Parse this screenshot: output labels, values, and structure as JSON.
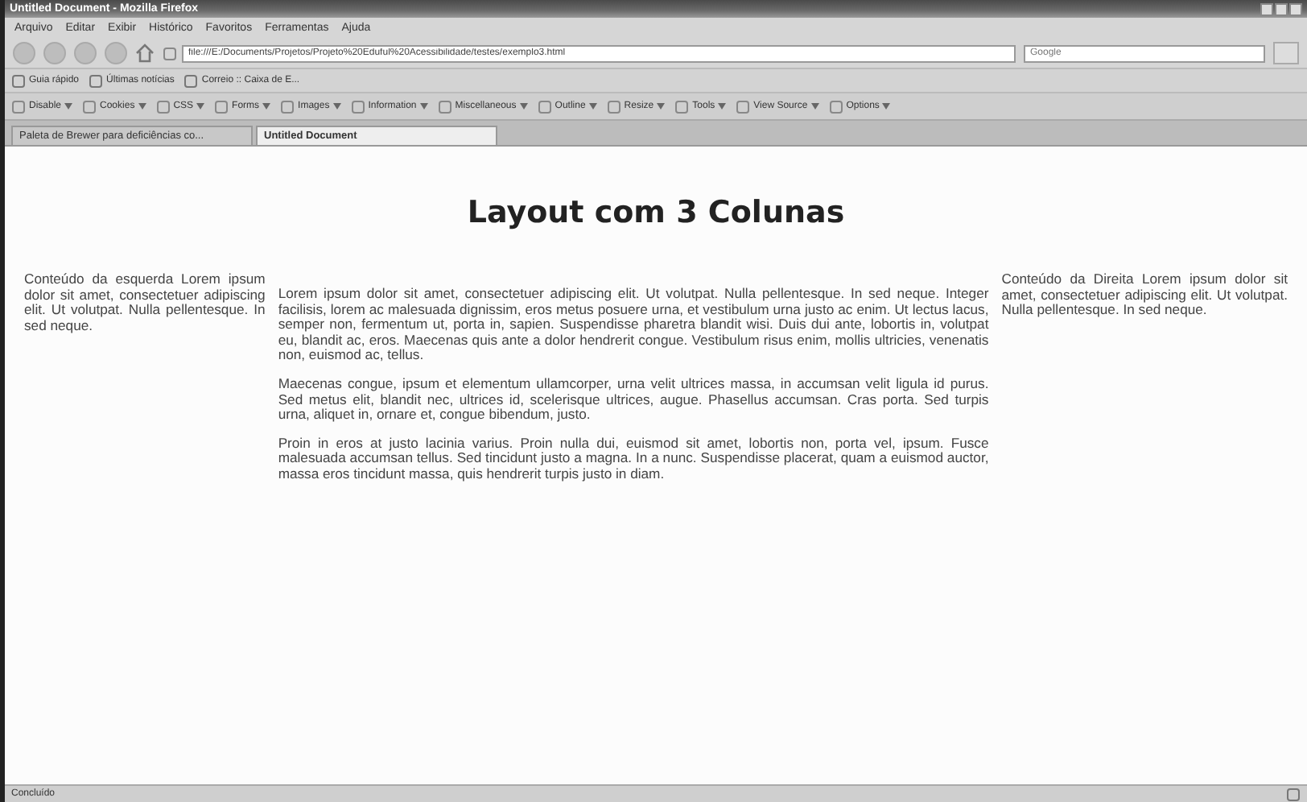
{
  "window": {
    "title": "Untitled Document - Mozilla Firefox"
  },
  "menu": [
    "Arquivo",
    "Editar",
    "Exibir",
    "Histórico",
    "Favoritos",
    "Ferramentas",
    "Ajuda"
  ],
  "address_bar": {
    "value": "file:///E:/Documents/Projetos/Projeto%20Eduful%20Acessibilidade/testes/exemplo3.html"
  },
  "search": {
    "placeholder": "Google"
  },
  "bookmarks": [
    "Guia rápido",
    "Últimas notícias",
    "Correio :: Caixa de E..."
  ],
  "webdev_toolbar": [
    "Disable",
    "Cookies",
    "CSS",
    "Forms",
    "Images",
    "Information",
    "Miscellaneous",
    "Outline",
    "Resize",
    "Tools",
    "View Source",
    "Options"
  ],
  "tabs": [
    {
      "label": "Paleta de Brewer para deficiências co...",
      "selected": false
    },
    {
      "label": "Untitled Document",
      "selected": true
    }
  ],
  "page": {
    "heading": "Layout com 3 Colunas",
    "left": "Conteúdo da esquerda Lorem ipsum dolor sit amet, consectetuer adipiscing elit. Ut volutpat. Nulla pellentesque. In sed neque.",
    "center": [
      "Lorem ipsum dolor sit amet, consectetuer adipiscing elit. Ut volutpat. Nulla pellentesque. In sed neque. Integer facilisis, lorem ac malesuada dignissim, eros metus posuere urna, et vestibulum urna justo ac enim. Ut lectus lacus, semper non, fermentum ut, porta in, sapien. Suspendisse pharetra blandit wisi. Duis dui ante, lobortis in, volutpat eu, blandit ac, eros. Maecenas quis ante a dolor hendrerit congue. Vestibulum risus enim, mollis ultricies, venenatis non, euismod ac, tellus.",
      "Maecenas congue, ipsum et elementum ullamcorper, urna velit ultrices massa, in accumsan velit ligula id purus. Sed metus elit, blandit nec, ultrices id, scelerisque ultrices, augue. Phasellus accumsan. Cras porta. Sed turpis urna, aliquet in, ornare et, congue bibendum, justo.",
      "Proin in eros at justo lacinia varius. Proin nulla dui, euismod sit amet, lobortis non, porta vel, ipsum. Fusce malesuada accumsan tellus. Sed tincidunt justo a magna. In a nunc. Suspendisse placerat, quam a euismod auctor, massa eros tincidunt massa, quis hendrerit turpis justo in diam."
    ],
    "right": "Conteúdo da Direita Lorem ipsum dolor sit amet, consectetuer adipiscing elit. Ut volutpat. Nulla pellentesque. In sed neque."
  },
  "status_bar": {
    "text": "Concluído"
  }
}
